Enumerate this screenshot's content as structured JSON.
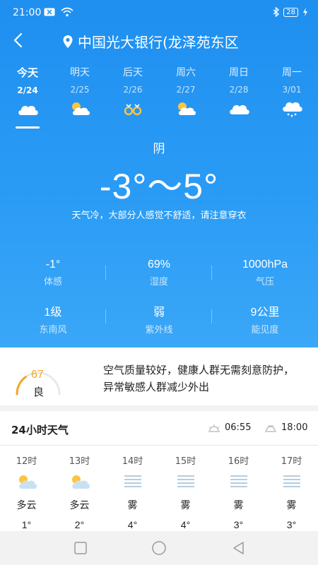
{
  "status": {
    "time": "21:00",
    "battery": "28"
  },
  "location": {
    "name": "中国光大银行(龙泽苑东区"
  },
  "days": [
    {
      "name": "今天",
      "date": "2/24",
      "icon": "cloudy-icon",
      "active": true
    },
    {
      "name": "明天",
      "date": "2/25",
      "icon": "partly-cloudy-icon"
    },
    {
      "name": "后天",
      "date": "2/26",
      "icon": "fog-icon"
    },
    {
      "name": "周六",
      "date": "2/27",
      "icon": "partly-cloudy-icon"
    },
    {
      "name": "周日",
      "date": "2/28",
      "icon": "cloudy-icon"
    },
    {
      "name": "周一",
      "date": "3/01",
      "icon": "snow-cloud-icon"
    }
  ],
  "current": {
    "condition": "阴",
    "temp_range": "-3°～5°",
    "tip": "天气冷，大部分人感觉不舒适，请注意穿衣"
  },
  "stats": [
    {
      "value": "-1°",
      "label": "体感"
    },
    {
      "value": "69%",
      "label": "湿度"
    },
    {
      "value": "1000hPa",
      "label": "气压"
    },
    {
      "value": "1级",
      "label": "东南风"
    },
    {
      "value": "弱",
      "label": "紫外线"
    },
    {
      "value": "9公里",
      "label": "能见度"
    }
  ],
  "aqi": {
    "value": "67",
    "level": "良",
    "fraction": 0.3,
    "color": "#f5a623",
    "description": "空气质量较好，健康人群无需刻意防护，异常敏感人群减少外出"
  },
  "hourly": {
    "title": "24小时天气",
    "sunrise": "06:55",
    "sunset": "18:00",
    "items": [
      {
        "time": "12时",
        "cond": "多云",
        "temp": "1°",
        "icon": "partly-cloudy-icon"
      },
      {
        "time": "13时",
        "cond": "多云",
        "temp": "2°",
        "icon": "partly-cloudy-icon"
      },
      {
        "time": "14时",
        "cond": "雾",
        "temp": "4°",
        "icon": "fog-icon"
      },
      {
        "time": "15时",
        "cond": "雾",
        "temp": "4°",
        "icon": "fog-icon"
      },
      {
        "time": "16时",
        "cond": "雾",
        "temp": "3°",
        "icon": "fog-icon"
      },
      {
        "time": "17时",
        "cond": "雾",
        "temp": "3°",
        "icon": "fog-icon"
      }
    ]
  },
  "colors": {
    "hero": "#2a9bf5",
    "accent": "#f5a623"
  }
}
